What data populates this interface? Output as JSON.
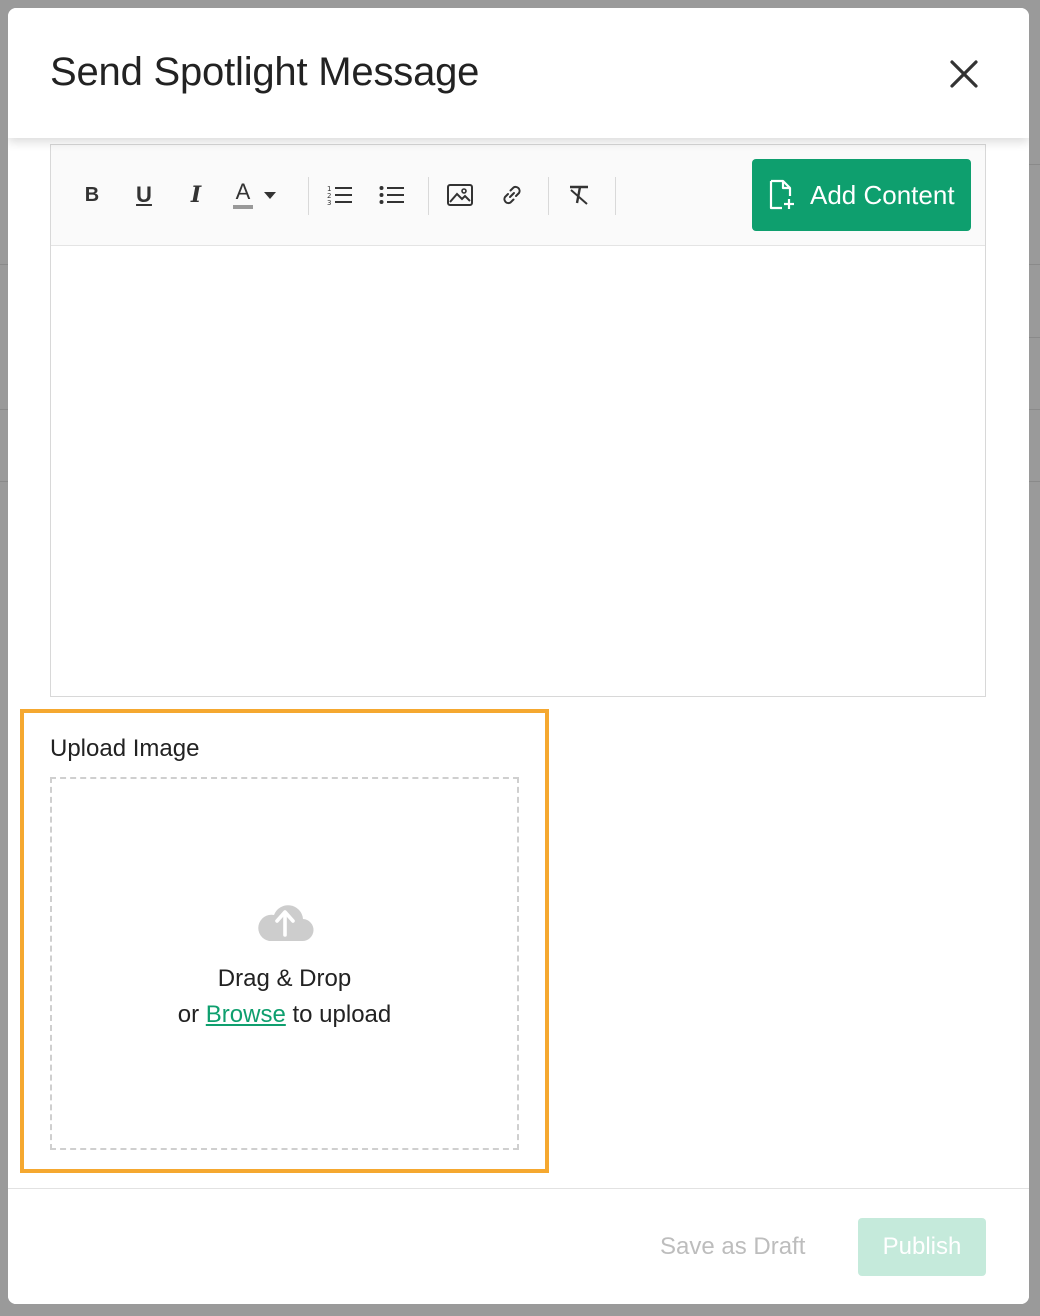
{
  "modal": {
    "title": "Send Spotlight Message",
    "close_icon": "close-icon"
  },
  "toolbar": {
    "bold_label": "B",
    "underline_label": "U",
    "italic_label": "I",
    "text_color_label": "A",
    "add_content_label": "Add Content"
  },
  "upload": {
    "label": "Upload Image",
    "drag_text": "Drag & Drop",
    "or_text": "or ",
    "browse_text": "Browse",
    "upload_text": " to upload"
  },
  "footer": {
    "save_draft_label": "Save as Draft",
    "publish_label": "Publish"
  },
  "colors": {
    "accent": "#0e9f6e",
    "highlight": "#f5a830",
    "publish_disabled": "#c5eadb"
  }
}
